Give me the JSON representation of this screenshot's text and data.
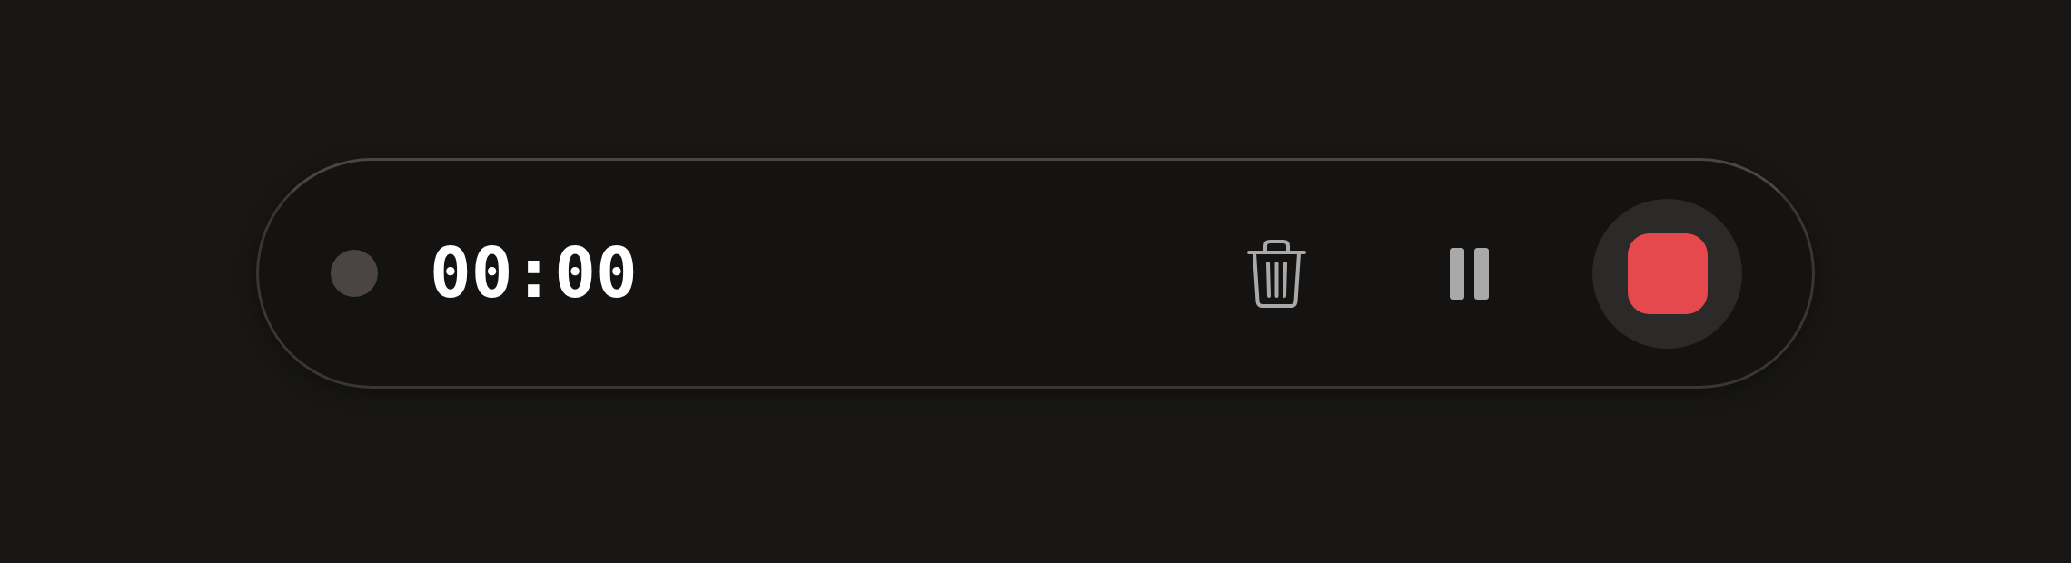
{
  "recorder": {
    "indicator": {
      "active": false
    },
    "time": "00:00",
    "controls": [
      {
        "kind": "delete"
      },
      {
        "kind": "pause"
      },
      {
        "kind": "stop"
      }
    ]
  }
}
